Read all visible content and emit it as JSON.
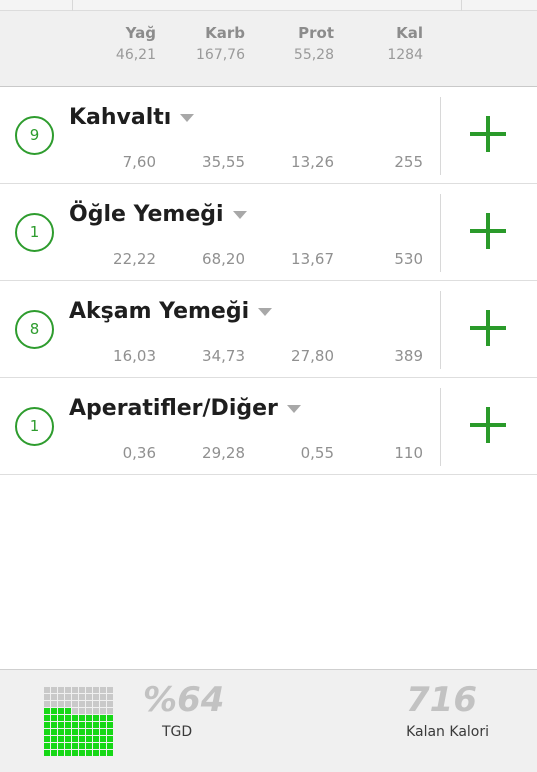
{
  "summary": {
    "headers": [
      "Yağ",
      "Karb",
      "Prot",
      "Kal"
    ],
    "values": [
      "46,21",
      "167,76",
      "55,28",
      "1284"
    ]
  },
  "meals": [
    {
      "count": "9",
      "title": "Kahvaltı",
      "values": [
        "7,60",
        "35,55",
        "13,26",
        "255"
      ]
    },
    {
      "count": "1",
      "title": "Öğle Yemeği",
      "values": [
        "22,22",
        "68,20",
        "13,67",
        "530"
      ]
    },
    {
      "count": "8",
      "title": "Akşam Yemeği",
      "values": [
        "16,03",
        "34,73",
        "27,80",
        "389"
      ]
    },
    {
      "count": "1",
      "title": "Aperatifler/Diğer",
      "values": [
        "0,36",
        "29,28",
        "0,55",
        "110"
      ]
    }
  ],
  "footer": {
    "tgd_percent": "%64",
    "tgd_fraction": 0.64,
    "tgd_label": "TGD",
    "remaining_value": "716",
    "remaining_label": "Kalan Kalori"
  },
  "colors": {
    "accent_green": "#2a9a2a",
    "waffle_on": "#16d816",
    "waffle_off": "#c9c9c9"
  },
  "icons": {
    "add": "plus-icon",
    "dropdown": "caret-down-icon"
  }
}
